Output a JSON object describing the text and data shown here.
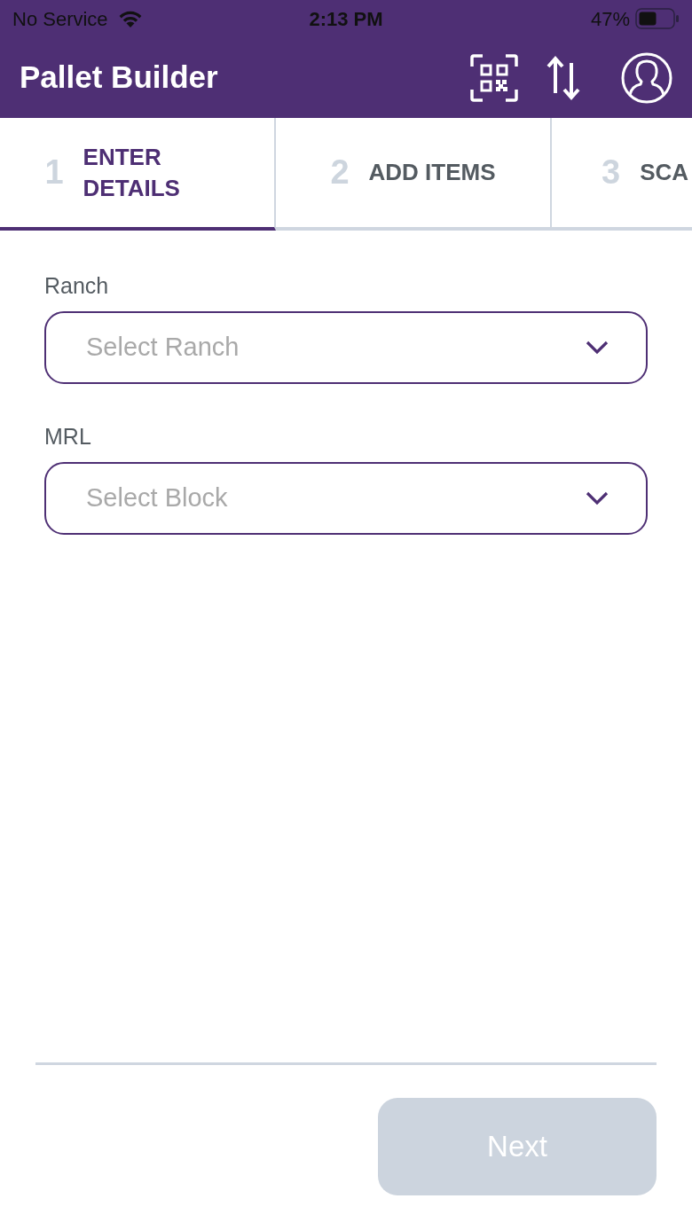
{
  "status_bar": {
    "carrier": "No Service",
    "time": "2:13 PM",
    "battery": "47%"
  },
  "header": {
    "title": "Pallet Builder"
  },
  "steps": [
    {
      "number": "1",
      "label": "ENTER DETAILS",
      "selected": true
    },
    {
      "number": "2",
      "label": "ADD ITEMS",
      "selected": false
    },
    {
      "number": "3",
      "label": "SCA",
      "selected": false
    }
  ],
  "form": {
    "fields": [
      {
        "label": "Ranch",
        "placeholder": "Select Ranch"
      },
      {
        "label": "MRL",
        "placeholder": "Select Block"
      }
    ]
  },
  "footer": {
    "next_button": {
      "label": "Next",
      "disabled": true
    }
  }
}
